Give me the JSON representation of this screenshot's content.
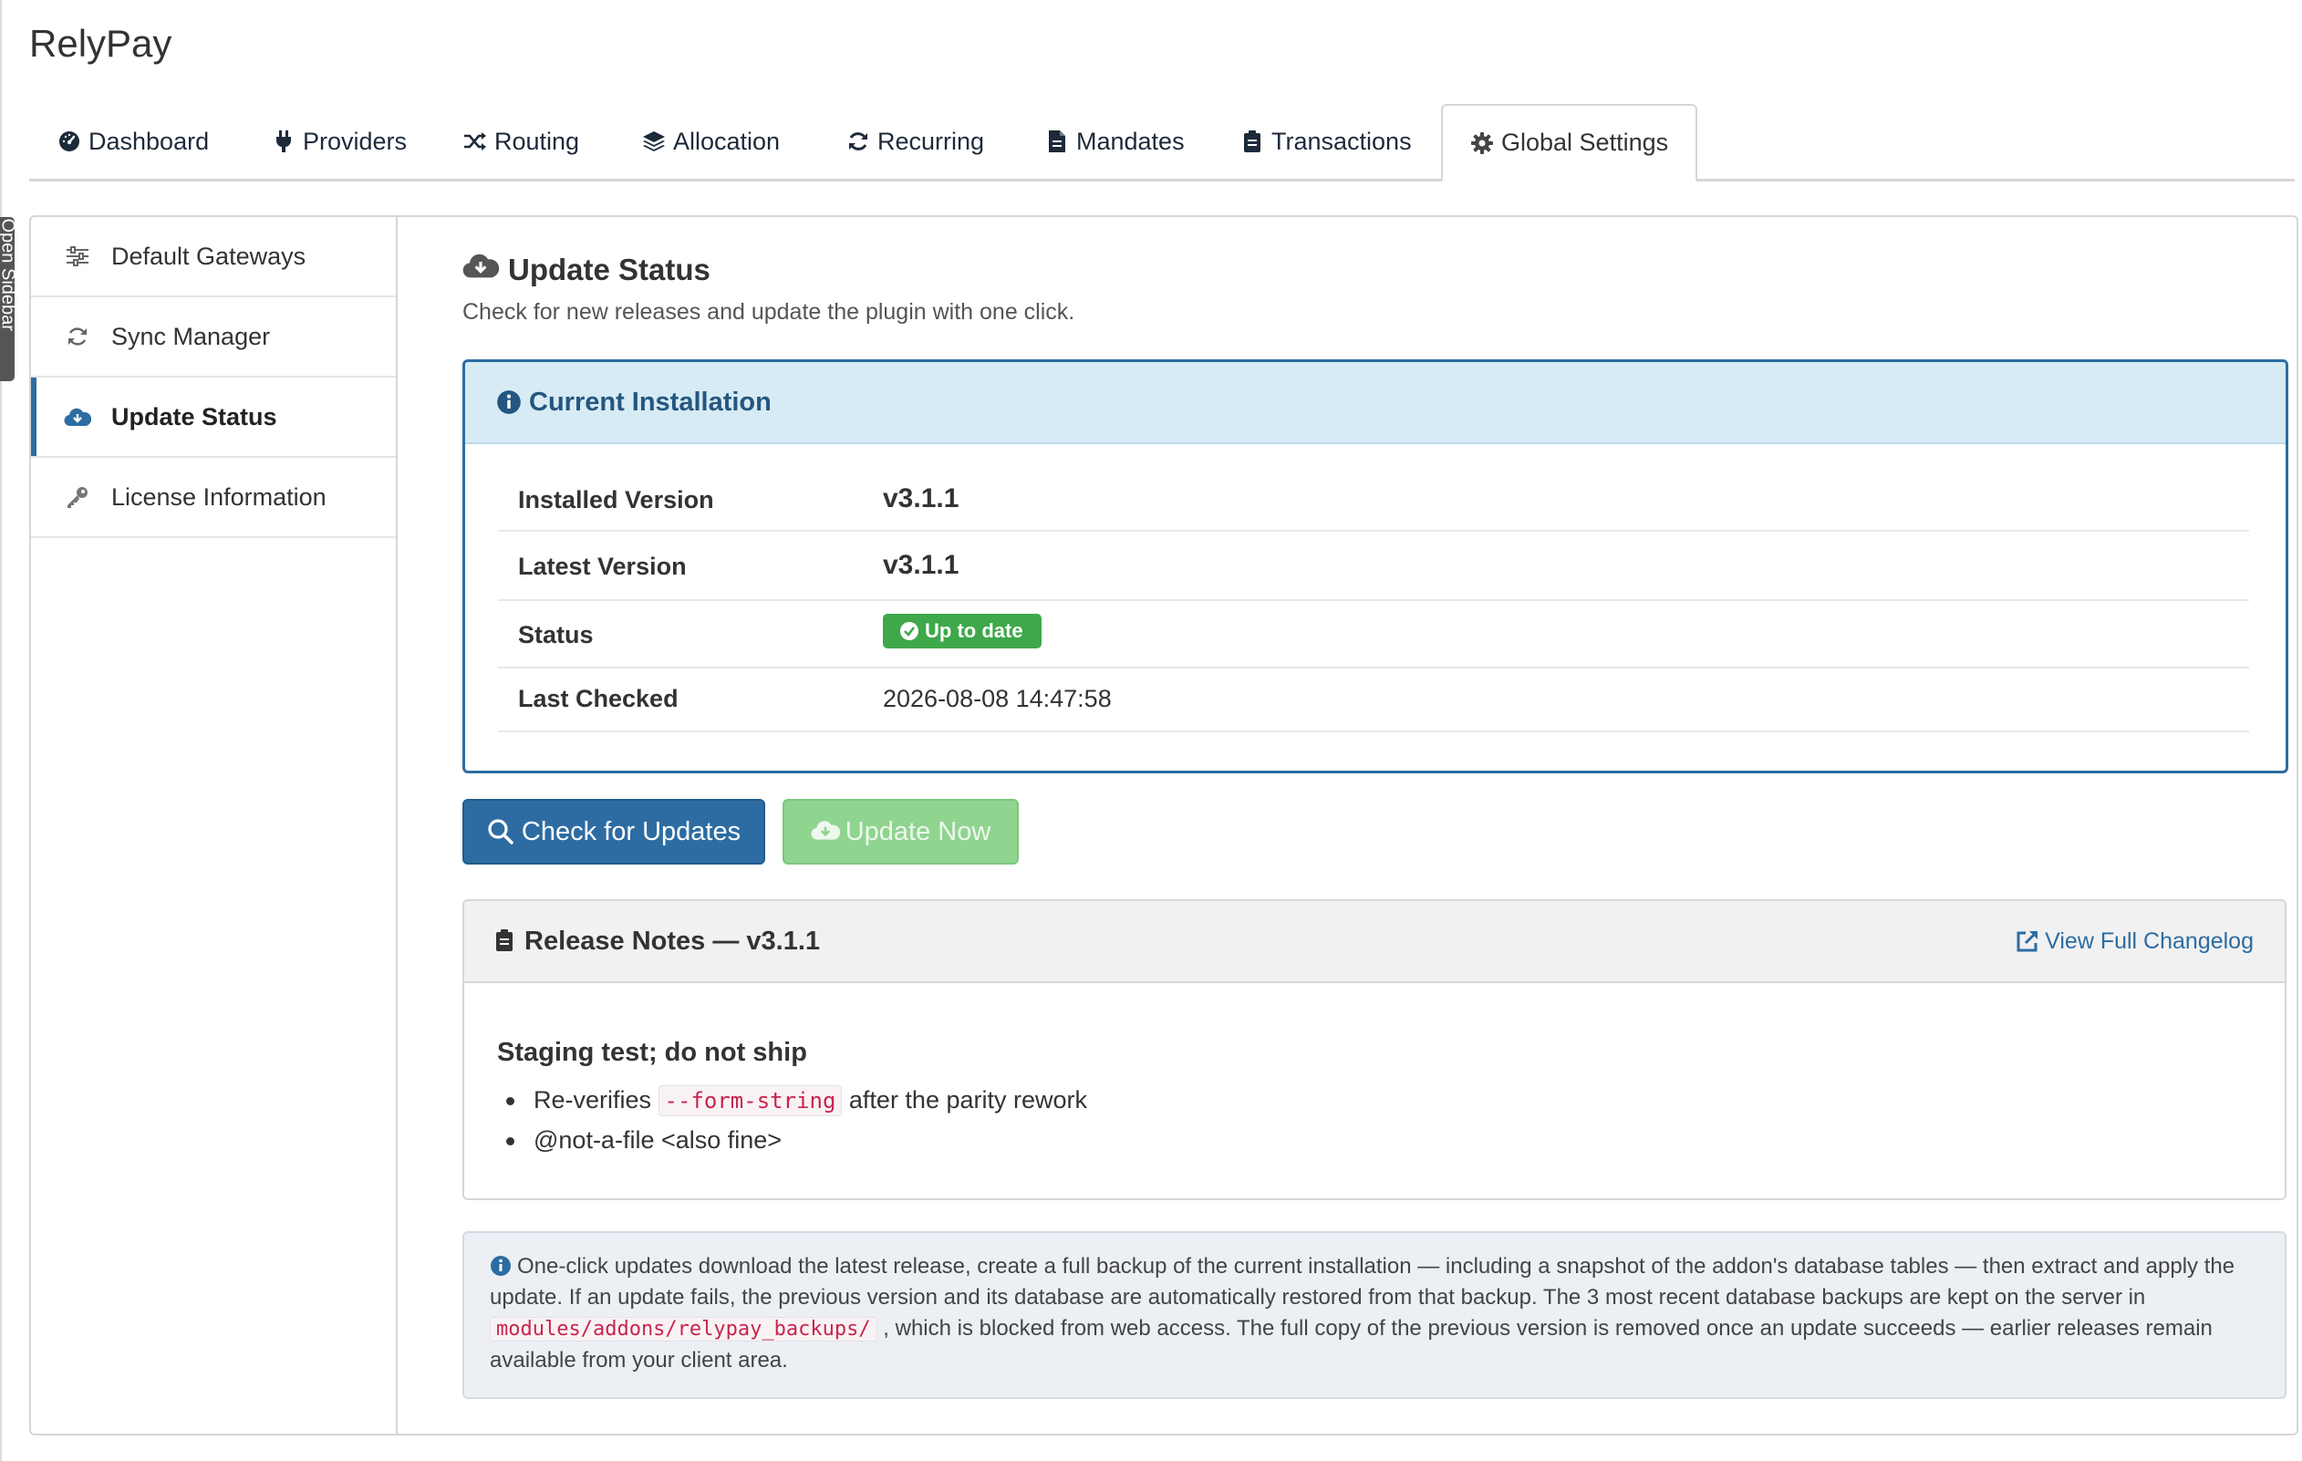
{
  "app": {
    "title": "RelyPay",
    "sidebar_toggle": "Open Sidebar"
  },
  "tabs": [
    {
      "label": "Dashboard",
      "icon": "dashboard-icon"
    },
    {
      "label": "Providers",
      "icon": "plug-icon"
    },
    {
      "label": "Routing",
      "icon": "shuffle-icon"
    },
    {
      "label": "Allocation",
      "icon": "layers-icon"
    },
    {
      "label": "Recurring",
      "icon": "refresh-icon"
    },
    {
      "label": "Mandates",
      "icon": "file-icon"
    },
    {
      "label": "Transactions",
      "icon": "clipboard-icon"
    },
    {
      "label": "Global Settings",
      "icon": "gear-icon",
      "active": true
    }
  ],
  "sidenav": [
    {
      "label": "Default Gateways",
      "icon": "sliders-icon"
    },
    {
      "label": "Sync Manager",
      "icon": "sync-icon"
    },
    {
      "label": "Update Status",
      "icon": "cloud-download-icon",
      "active": true
    },
    {
      "label": "License Information",
      "icon": "key-icon"
    }
  ],
  "section": {
    "title": "Update Status",
    "subtitle": "Check for new releases and update the plugin with one click."
  },
  "installation": {
    "heading": "Current Installation",
    "rows": [
      {
        "label": "Installed Version",
        "value": "v3.1.1"
      },
      {
        "label": "Latest Version",
        "value": "v3.1.1"
      },
      {
        "label": "Status",
        "value": "Up to date"
      },
      {
        "label": "Last Checked",
        "value": "2026-08-08 14:47:58"
      }
    ]
  },
  "buttons": {
    "check": "Check for Updates",
    "update": "Update Now"
  },
  "release_notes": {
    "heading": "Release Notes — v3.1.1",
    "changelog_link": "View Full Changelog",
    "notes_title": "Staging test; do not ship",
    "item1_before": "Re-verifies",
    "item1_code": "--form-string",
    "item1_after": "after the parity rework",
    "item2": "@not-a-file <also fine>"
  },
  "notice": {
    "text_before": "One-click updates download the latest release, create a full backup of the current installation — including a snapshot of the addon's database tables — then extract and apply the update. If an update fails, the previous version and its database are automatically restored from that backup. The 3 most recent database backups are kept on the server in",
    "path": "modules/addons/relypay_backups/",
    "text_after": ", which is blocked from web access. The full copy of the previous version is removed once an update succeeds — earlier releases remain available from your client area."
  },
  "colors": {
    "primary": "#2d6ca2",
    "success": "#3ea84a",
    "success_disabled": "#8fd48f",
    "info_bg": "#d7ebf5"
  }
}
